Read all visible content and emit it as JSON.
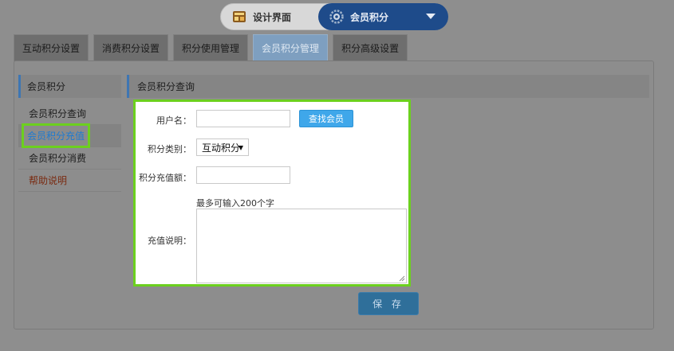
{
  "switcher": {
    "left_label": "设计界面",
    "right_label": "会员积分",
    "left_icon": "design-icon",
    "right_icon": "gear-icon"
  },
  "tabs": [
    {
      "label": "互动积分设置"
    },
    {
      "label": "消费积分设置"
    },
    {
      "label": "积分使用管理"
    },
    {
      "label": "会员积分管理",
      "active": true
    },
    {
      "label": "积分高级设置"
    }
  ],
  "sidebar": {
    "title": "会员积分",
    "items": [
      {
        "label": "会员积分查询"
      },
      {
        "label": "会员积分充值",
        "active": true
      },
      {
        "label": "会员积分消费"
      },
      {
        "label": "帮助说明"
      }
    ]
  },
  "main": {
    "title": "会员积分查询"
  },
  "form": {
    "username_label": "用户名：",
    "username_value": "",
    "find_button": "查找会员",
    "category_label": "积分类别：",
    "category_value": "互动积分",
    "amount_label": "积分充值额：",
    "amount_value": "",
    "hint": "最多可输入200个字",
    "desc_label": "充值说明：",
    "desc_value": "",
    "save_button": "保 存"
  },
  "colors": {
    "highlight": "#6cd01e",
    "accent": "#3fa7ea",
    "switcher_active": "#1e4b8a"
  }
}
